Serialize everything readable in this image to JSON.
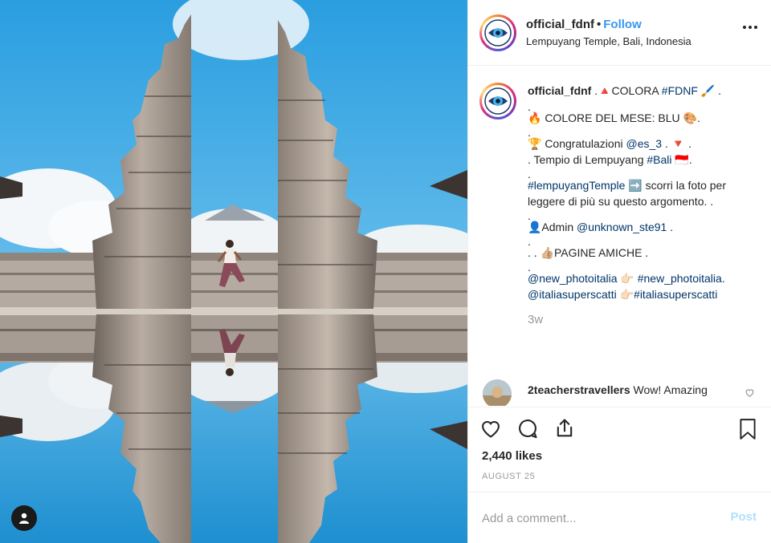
{
  "post": {
    "username": "official_fdnf",
    "follow_label": "Follow",
    "separator": "•",
    "location": "Lempuyang Temple, Bali, Indonesia"
  },
  "caption": {
    "username": "official_fdnf",
    "line1_a": " .🔺COLORA ",
    "line1_tag": "#FDNF",
    "line1_b": " 🖌️ .",
    "dot1": ".",
    "line2": "🔥 COLORE DEL MESE: BLU 🎨.",
    "dot2": ".",
    "line3_a": "🏆 Congratulazioni ",
    "line3_tag": "@es_3",
    "line3_b": " . 🔻 .",
    "line4_a": ". Tempio di Lempuyang ",
    "line4_tag": "#Bali",
    "line4_b": " 🇮🇩.",
    "dot3": ".",
    "line5_tag": "#lempuyangTemple",
    "line5_b": " ➡️ scorri la foto per leggere di più su questo argomento. .",
    "dot4": ".",
    "line6_a": "👤Admin ",
    "line6_tag": "@unknown_ste91",
    "line6_b": " .",
    "dot5": ".",
    "line7": ". . 👍🏼PAGINE AMICHE .",
    "dot6": ".",
    "line8_tag1": "@new_photoitalia",
    "line8_mid": " 👉🏻 ",
    "line8_tag2": "#new_photoitalia.",
    "line9_tag1": "@italiasuperscatti",
    "line9_mid": " 👉🏻",
    "line9_tag2": "#italiasuperscatti",
    "time": "3w"
  },
  "comment": {
    "username": "2teacherstravellers",
    "text": " Wow! Amazing"
  },
  "actions": {
    "likes": "2,440 likes",
    "date": "AUGUST 25"
  },
  "add_comment": {
    "placeholder": "Add a comment...",
    "post_label": "Post"
  },
  "colors": {
    "link": "#003569",
    "follow": "#3897f0",
    "post_disabled": "#b2dffc",
    "muted": "#999999",
    "sky": "#3a9fd8"
  },
  "icons": [
    "user-tag-icon",
    "more-icon",
    "heart-icon",
    "comment-icon",
    "share-icon",
    "bookmark-icon",
    "small-heart-icon",
    "eye-logo-icon"
  ]
}
